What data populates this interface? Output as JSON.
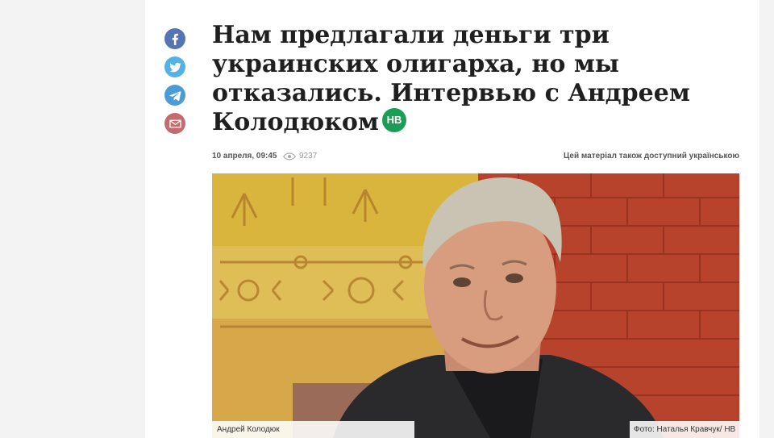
{
  "share": {
    "icons": [
      "facebook-icon",
      "twitter-icon",
      "telegram-icon",
      "mail-icon"
    ],
    "colors": [
      "#5574b4",
      "#52b2e4",
      "#4a9cd7",
      "#c46b70"
    ]
  },
  "article": {
    "title": "Нам предлагали деньги три украинских олигарха, но мы отказались. Интервью с Андреем Колодюком",
    "badge": "НВ",
    "date": "10 апреля, 09:45",
    "views": "9237",
    "ua_link": "Цей матеріал також доступний українською",
    "photo_caption": "Андрей Колодюк",
    "photo_credit": "Фото: Наталья Кравчук/ НВ"
  },
  "colors": {
    "badge": "#1a9e55",
    "page_bg": "#f3f3f3"
  }
}
